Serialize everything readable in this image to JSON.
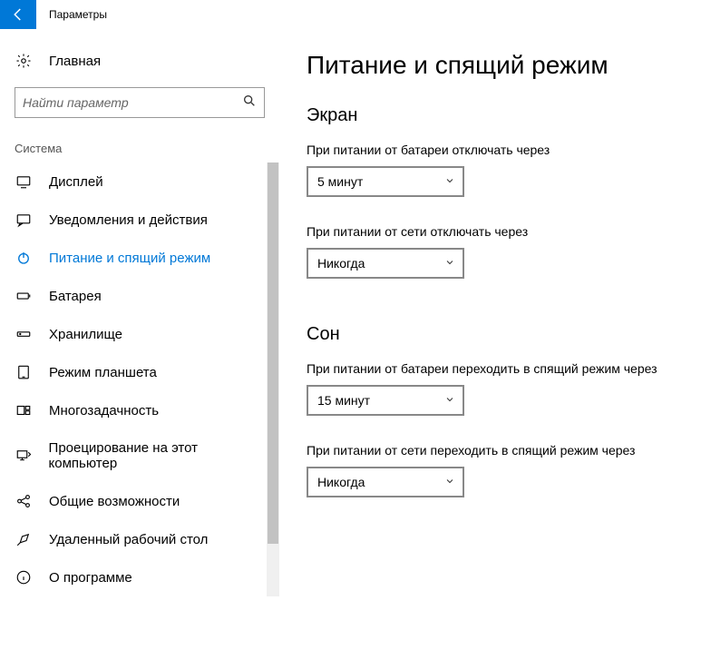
{
  "titlebar": {
    "title": "Параметры"
  },
  "home": {
    "label": "Главная"
  },
  "search": {
    "placeholder": "Найти параметр"
  },
  "section_label": "Система",
  "nav": [
    {
      "id": "display",
      "label": "Дисплей"
    },
    {
      "id": "notifications",
      "label": "Уведомления и действия"
    },
    {
      "id": "power",
      "label": "Питание и спящий режим"
    },
    {
      "id": "battery",
      "label": "Батарея"
    },
    {
      "id": "storage",
      "label": "Хранилище"
    },
    {
      "id": "tablet",
      "label": "Режим планшета"
    },
    {
      "id": "multitasking",
      "label": "Многозадачность"
    },
    {
      "id": "projecting",
      "label": "Проецирование на этот компьютер"
    },
    {
      "id": "shared",
      "label": "Общие возможности"
    },
    {
      "id": "remote",
      "label": "Удаленный рабочий стол"
    },
    {
      "id": "about",
      "label": "О программе"
    }
  ],
  "main": {
    "title": "Питание и спящий режим",
    "group1": {
      "title": "Экран",
      "setting1": {
        "label": "При питании от батареи отключать через",
        "value": "5 минут"
      },
      "setting2": {
        "label": "При питании от сети отключать через",
        "value": "Никогда"
      }
    },
    "group2": {
      "title": "Сон",
      "setting1": {
        "label": "При питании от батареи переходить в спящий режим через",
        "value": "15 минут"
      },
      "setting2": {
        "label": "При питании от сети переходить в спящий режим через",
        "value": "Никогда"
      }
    }
  }
}
